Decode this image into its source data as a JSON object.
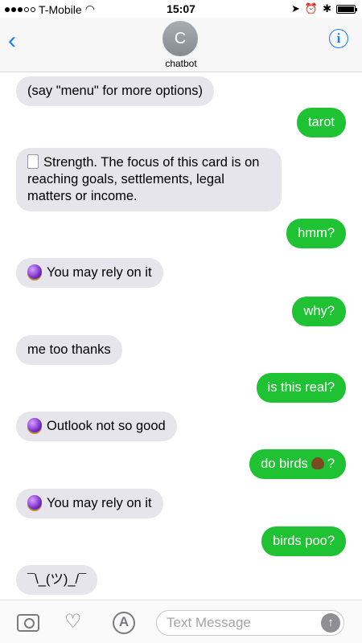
{
  "status_bar": {
    "carrier": "T-Mobile",
    "time": "15:07"
  },
  "nav": {
    "back_icon": "chevron-left-icon",
    "avatar_initial": "C",
    "contact_name": "chatbot",
    "info_label": "i"
  },
  "messages": [
    {
      "from": "bot",
      "text": "(say \"menu\" for more options)"
    },
    {
      "from": "me",
      "text": "tarot"
    },
    {
      "from": "bot",
      "emoji": "card",
      "text": "Strength. The focus of this card is on reaching goals, settlements, legal matters or income."
    },
    {
      "from": "me",
      "text": "hmm?"
    },
    {
      "from": "bot",
      "emoji": "crystal-ball",
      "text": "You may rely on it"
    },
    {
      "from": "me",
      "text": "why?"
    },
    {
      "from": "bot",
      "text": "me too thanks"
    },
    {
      "from": "me",
      "text": "is this real?"
    },
    {
      "from": "bot",
      "emoji": "crystal-ball",
      "text": "Outlook not so good"
    },
    {
      "from": "me",
      "text_before": "do birds",
      "text_after": "?"
    },
    {
      "from": "bot",
      "emoji": "crystal-ball",
      "text": "You may rely on it"
    },
    {
      "from": "me",
      "text": "birds poo?"
    },
    {
      "from": "bot",
      "text": "¯\\_(ツ)_/¯"
    }
  ],
  "composer": {
    "placeholder": "Text Message"
  },
  "colors": {
    "accent": "#147efb",
    "sent_bubble": "#1ec233",
    "received_bubble": "#e6e5eb"
  }
}
